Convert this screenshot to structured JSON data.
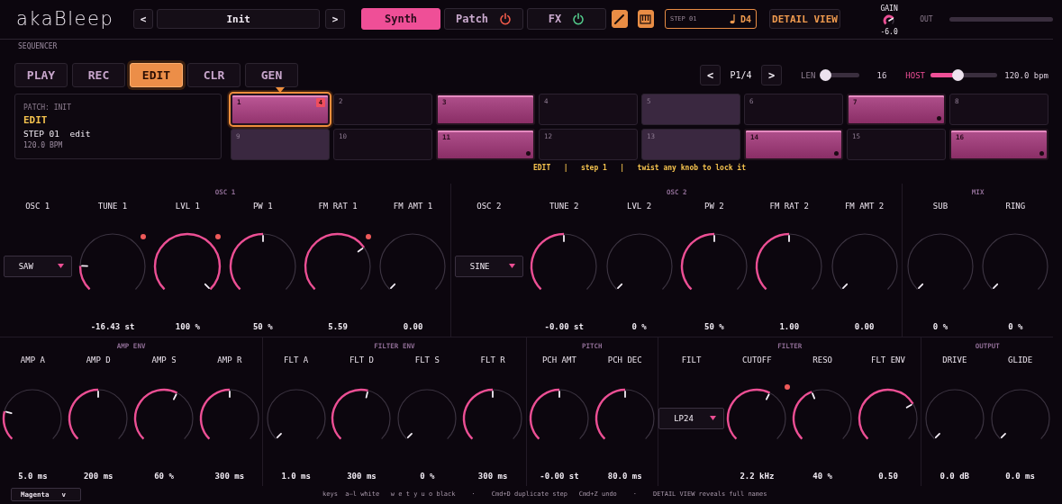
{
  "app": {
    "logo": "akaBleep"
  },
  "preset": {
    "prev": "<",
    "name": "Init",
    "next": ">"
  },
  "tabs": [
    {
      "label": "Synth",
      "selected": true
    },
    {
      "label": "Patch",
      "selected": false,
      "power": false
    },
    {
      "label": "FX",
      "selected": false,
      "power": true
    }
  ],
  "tools": [
    {
      "kind": "pencil",
      "on": true
    },
    {
      "kind": "piano",
      "on": true
    }
  ],
  "step_display": {
    "step": "STEP 01",
    "note": "D4"
  },
  "detail_button": "DETAIL VIEW",
  "gain": {
    "label": "GAIN",
    "value": "-6.0"
  },
  "output": {
    "label": "OUT",
    "level": 0
  },
  "sequencer": {
    "title": "SEQUENCER",
    "modes": [
      {
        "label": "PLAY",
        "selected": false
      },
      {
        "label": "REC",
        "selected": false
      },
      {
        "label": "EDIT",
        "selected": true
      },
      {
        "label": "CLR",
        "selected": false
      },
      {
        "label": "GEN",
        "selected": false
      }
    ],
    "page": {
      "prev": "<",
      "label": "P1/4",
      "next": ">"
    },
    "length": {
      "label": "LEN",
      "level": 0.12,
      "value": "16"
    },
    "host": {
      "label": "HOST",
      "level": 0.4,
      "value": "120.0 bpm"
    },
    "info": {
      "patch": "PATCH: INIT",
      "mode": "EDIT",
      "step": "STEP 01  edit",
      "tempo": "120.0 BPM"
    },
    "steps": [
      {
        "number": "1",
        "active": true,
        "beat": true,
        "selected": true,
        "badge": "4",
        "lock": false
      },
      {
        "number": "2",
        "active": false,
        "beat": false,
        "selected": false,
        "lock": false
      },
      {
        "number": "3",
        "active": true,
        "beat": false,
        "selected": false,
        "lock": false
      },
      {
        "number": "4",
        "active": false,
        "beat": false,
        "selected": false,
        "lock": false
      },
      {
        "number": "5",
        "active": false,
        "beat": true,
        "selected": false,
        "lock": false
      },
      {
        "number": "6",
        "active": false,
        "beat": false,
        "selected": false,
        "lock": false
      },
      {
        "number": "7",
        "active": true,
        "beat": false,
        "selected": false,
        "lock": true
      },
      {
        "number": "8",
        "active": false,
        "beat": false,
        "selected": false,
        "lock": false
      },
      {
        "number": "9",
        "active": false,
        "beat": true,
        "selected": false,
        "lock": false
      },
      {
        "number": "10",
        "active": false,
        "beat": false,
        "selected": false,
        "lock": false
      },
      {
        "number": "11",
        "active": true,
        "beat": false,
        "selected": false,
        "lock": true
      },
      {
        "number": "12",
        "active": false,
        "beat": false,
        "selected": false,
        "lock": false
      },
      {
        "number": "13",
        "active": false,
        "beat": true,
        "selected": false,
        "lock": false
      },
      {
        "number": "14",
        "active": true,
        "beat": false,
        "selected": false,
        "lock": true
      },
      {
        "number": "15",
        "active": false,
        "beat": false,
        "selected": false,
        "lock": false
      },
      {
        "number": "16",
        "active": true,
        "beat": false,
        "selected": false,
        "lock": true
      }
    ],
    "hint": "EDIT   |   step 1   |   twist any knob to lock it"
  },
  "panels": [
    {
      "sections": [
        {
          "title": "OSC 1",
          "controls": [
            {
              "kind": "select",
              "label": "OSC 1",
              "value": "SAW"
            },
            {
              "kind": "knob",
              "label": "TUNE 1",
              "value": "-16.43 st",
              "locked": true
            },
            {
              "kind": "knob",
              "label": "LVL 1",
              "value": "100 %",
              "locked": true
            },
            {
              "kind": "knob",
              "label": "PW 1",
              "value": "50 %",
              "locked": false
            },
            {
              "kind": "knob",
              "label": "FM RAT 1",
              "value": "5.59",
              "locked": true
            },
            {
              "kind": "knob",
              "label": "FM AMT 1",
              "value": "0.00",
              "locked": false
            }
          ]
        },
        {
          "title": "OSC 2",
          "controls": [
            {
              "kind": "select",
              "label": "OSC 2",
              "value": "SINE"
            },
            {
              "kind": "knob",
              "label": "TUNE 2",
              "value": "-0.00 st",
              "locked": false
            },
            {
              "kind": "knob",
              "label": "LVL 2",
              "value": "0 %",
              "locked": false
            },
            {
              "kind": "knob",
              "label": "PW 2",
              "value": "50 %",
              "locked": false
            },
            {
              "kind": "knob",
              "label": "FM RAT 2",
              "value": "1.00",
              "locked": false
            },
            {
              "kind": "knob",
              "label": "FM AMT 2",
              "value": "0.00",
              "locked": false
            }
          ]
        },
        {
          "title": "MIX",
          "controls": [
            {
              "kind": "knob",
              "label": "SUB",
              "value": "0 %",
              "locked": false
            },
            {
              "kind": "knob",
              "label": "RING",
              "value": "0 %",
              "locked": false
            }
          ]
        }
      ]
    },
    {
      "sections": [
        {
          "title": "AMP ENV",
          "controls": [
            {
              "kind": "knob",
              "label": "AMP A",
              "value": "5.0 ms",
              "locked": false
            },
            {
              "kind": "knob",
              "label": "AMP D",
              "value": "200 ms",
              "locked": false
            },
            {
              "kind": "knob",
              "label": "AMP S",
              "value": "60 %",
              "locked": false
            },
            {
              "kind": "knob",
              "label": "AMP R",
              "value": "300 ms",
              "locked": false
            }
          ]
        },
        {
          "title": "FILTER ENV",
          "controls": [
            {
              "kind": "knob",
              "label": "FLT A",
              "value": "1.0 ms",
              "locked": false
            },
            {
              "kind": "knob",
              "label": "FLT D",
              "value": "300 ms",
              "locked": false
            },
            {
              "kind": "knob",
              "label": "FLT S",
              "value": "0 %",
              "locked": false
            },
            {
              "kind": "knob",
              "label": "FLT R",
              "value": "300 ms",
              "locked": false
            }
          ]
        },
        {
          "title": "PITCH",
          "controls": [
            {
              "kind": "knob",
              "label": "PCH AMT",
              "value": "-0.00 st",
              "locked": false
            },
            {
              "kind": "knob",
              "label": "PCH DEC",
              "value": "80.0 ms",
              "locked": false
            }
          ]
        },
        {
          "title": "FILTER",
          "controls": [
            {
              "kind": "select",
              "label": "FILT",
              "value": "LP24"
            },
            {
              "kind": "knob",
              "label": "CUTOFF",
              "value": "2.2 kHz",
              "locked": true
            },
            {
              "kind": "knob",
              "label": "RESO",
              "value": "40 %",
              "locked": false
            },
            {
              "kind": "knob",
              "label": "FLT ENV",
              "value": "0.50",
              "locked": false
            }
          ]
        },
        {
          "title": "OUTPUT",
          "controls": [
            {
              "kind": "knob",
              "label": "DRIVE",
              "value": "0.0 dB",
              "locked": false
            },
            {
              "kind": "knob",
              "label": "GLIDE",
              "value": "0.0 ms",
              "locked": false
            }
          ]
        }
      ]
    }
  ],
  "footer": {
    "theme": "Magenta",
    "theme_caret": "v",
    "separator": "·",
    "hints": [
      "keys  a–l white   w e t y u o black",
      "Cmd+D duplicate step   Cmd+Z undo",
      "DETAIL VIEW reveals full names"
    ]
  }
}
